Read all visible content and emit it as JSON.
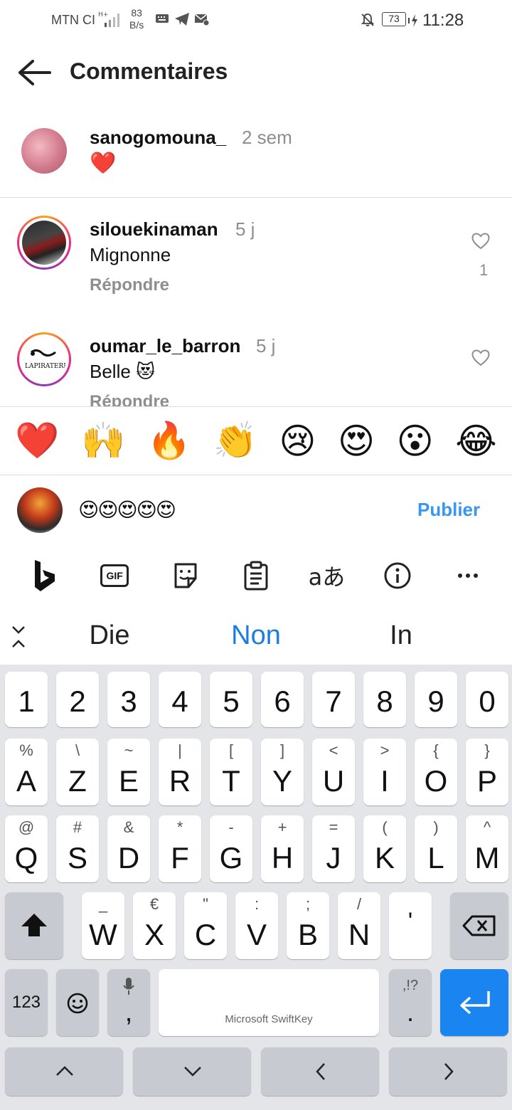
{
  "status": {
    "carrier": "MTN CI",
    "speed_value": "83",
    "speed_unit": "B/s",
    "battery": "73",
    "time": "11:28"
  },
  "header": {
    "title": "Commentaires"
  },
  "caption": {
    "username": "sanogomouna_",
    "age": "2 sem",
    "text": "❤️"
  },
  "comments": [
    {
      "username": "silouekinaman",
      "age": "5 j",
      "text": "Mignonne",
      "reply": "Répondre",
      "likes": "1"
    },
    {
      "username": "oumar_le_barron",
      "age": "5 j",
      "text": "Belle 😻",
      "reply": "Répondre",
      "likes": ""
    }
  ],
  "reactions": [
    "❤️",
    "🙌",
    "🔥",
    "👏",
    "😢",
    "😍",
    "😮",
    "😂"
  ],
  "composer": {
    "text": "😍😍😍😍😍",
    "publish": "Publier"
  },
  "keyboard_tools": {
    "gif": "GIF",
    "translate": "aあ"
  },
  "suggestions": [
    "Die",
    "Non",
    "In"
  ],
  "keyboard": {
    "numbers": [
      "1",
      "2",
      "3",
      "4",
      "5",
      "6",
      "7",
      "8",
      "9",
      "0"
    ],
    "row1": [
      [
        "A",
        "%"
      ],
      [
        "Z",
        "\\"
      ],
      [
        "E",
        "~"
      ],
      [
        "R",
        "|"
      ],
      [
        "T",
        "["
      ],
      [
        "Y",
        "]"
      ],
      [
        "U",
        "<"
      ],
      [
        "I",
        ">"
      ],
      [
        "O",
        "{"
      ],
      [
        "P",
        "}"
      ]
    ],
    "row2": [
      [
        "Q",
        "@"
      ],
      [
        "S",
        "#"
      ],
      [
        "D",
        "&"
      ],
      [
        "F",
        "*"
      ],
      [
        "G",
        "-"
      ],
      [
        "H",
        "+"
      ],
      [
        "J",
        "="
      ],
      [
        "K",
        "("
      ],
      [
        "L",
        ")"
      ],
      [
        "M",
        "^"
      ]
    ],
    "row3": [
      [
        "W",
        "_"
      ],
      [
        "X",
        "€"
      ],
      [
        "C",
        "\""
      ],
      [
        "V",
        ":"
      ],
      [
        "B",
        ";"
      ],
      [
        "N",
        "/"
      ],
      [
        "'",
        ""
      ]
    ],
    "numbers_key": "123",
    "comma": ",",
    "space": "Microsoft SwiftKey",
    "punct_top": ",!?",
    "punct_main": "."
  }
}
